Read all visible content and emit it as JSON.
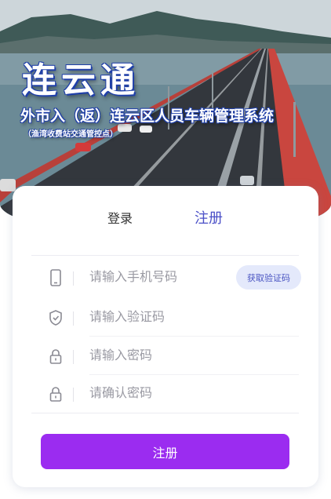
{
  "header": {
    "brand": "连云通",
    "title": "外市入（返）连云区人员车辆管理系统",
    "subtitle": "（渔湾收费站交通管控点）"
  },
  "tabs": [
    {
      "label": "登录",
      "active": false
    },
    {
      "label": "注册",
      "active": true
    }
  ],
  "form": {
    "phone_placeholder": "请输入手机号码",
    "get_code_label": "获取验证码",
    "code_placeholder": "请输入验证码",
    "password_placeholder": "请输入密码",
    "confirm_placeholder": "请确认密码",
    "submit_label": "注册"
  },
  "icons": {
    "phone": "phone-icon",
    "code": "shield-icon",
    "password": "lock-icon",
    "confirm": "lock-icon"
  },
  "colors": {
    "accent": "#4a4fc7",
    "submit": "#9b2cf0",
    "code_button_bg": "#e4e9fb"
  }
}
